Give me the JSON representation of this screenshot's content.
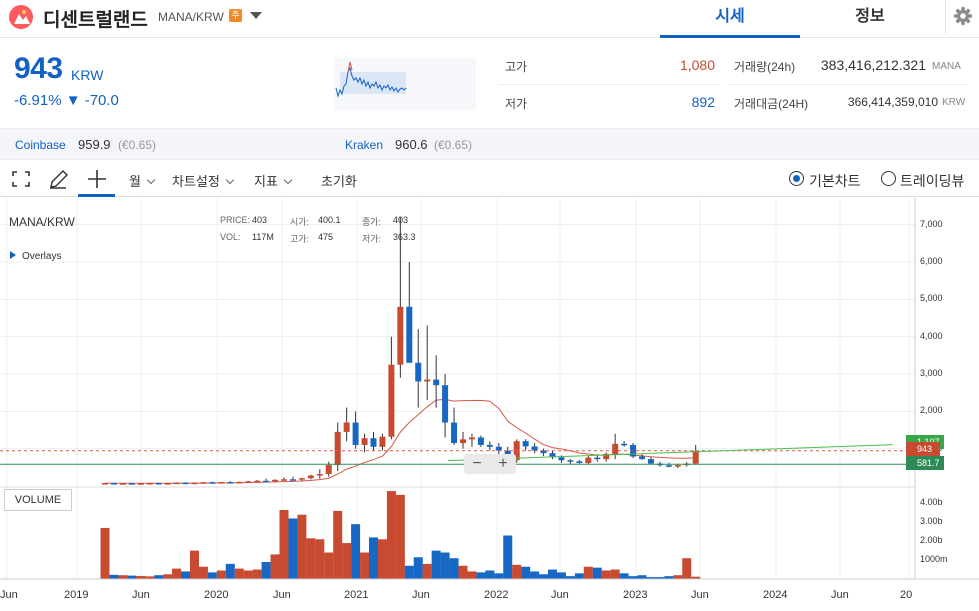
{
  "header": {
    "coin_name": "디센트럴랜드",
    "pair": "MANA/KRW",
    "warning_badge": "주",
    "tabs": [
      {
        "label": "시세"
      },
      {
        "label": "정보"
      }
    ]
  },
  "quote": {
    "price": "943",
    "unit": "KRW",
    "change": "-6.91% ▼ -70.0",
    "high_label": "고가",
    "high_value": "1,080",
    "low_label": "저가",
    "low_value": "892",
    "volume_label": "거래량(24h)",
    "volume_value": "383,416,212.321",
    "volume_unit": "MANA",
    "amount_label": "거래대금(24H)",
    "amount_value": "366,414,359,010",
    "amount_unit": "KRW"
  },
  "exchanges": [
    {
      "name": "Coinbase",
      "value": "959.9",
      "sub": "(€0.65)"
    },
    {
      "name": "Kraken",
      "value": "960.6",
      "sub": "(€0.65)"
    }
  ],
  "toolbar": {
    "period": "월",
    "chart_settings": "차트설정",
    "indicators": "지표",
    "reset": "초기화",
    "basic_chart": "기본차트",
    "tradingview": "트레이딩뷰"
  },
  "chart_panel": {
    "symbol": "MANA/KRW",
    "price_label": "PRICE:",
    "price_value": "403",
    "vol_label": "VOL:",
    "vol_value": "117M",
    "open_label": "시가:",
    "open_value": "400.1",
    "high_label": "고가:",
    "high_value": "475",
    "close_label": "종가:",
    "close_value": "403",
    "low_label": "저가:",
    "low_value": "363.3",
    "overlays": "Overlays",
    "volume_button": "VOLUME",
    "zoom_out": "−",
    "zoom_in": "+",
    "last_price_tag": "943",
    "green_tag": "1,107",
    "teal_tag": "581.7"
  },
  "colors": {
    "up": "#c84a31",
    "down": "#1768c5",
    "accent": "#1261c4"
  },
  "chart_data": {
    "type": "bar",
    "y_ticks": [
      "7,000",
      "6,000",
      "5,000",
      "4,000",
      "3,000",
      "2,000",
      "1,000"
    ],
    "vol_ticks": [
      "4.00b",
      "3.00b",
      "2.00b",
      "1000m"
    ],
    "x_ticks": [
      "Jun",
      "2019",
      "Jun",
      "2020",
      "Jun",
      "2021",
      "Jun",
      "2022",
      "Jun",
      "2023",
      "Jun",
      "2024",
      "Jun",
      "20"
    ],
    "ylim": [
      0,
      7500
    ],
    "vol_max": 4.6,
    "reference_lines": {
      "last_price": 943,
      "teal": 581.7,
      "green_end": 1107
    },
    "ohlc": [
      [
        75,
        80,
        60,
        78
      ],
      [
        78,
        85,
        65,
        72
      ],
      [
        72,
        80,
        60,
        75
      ],
      [
        75,
        82,
        62,
        70
      ],
      [
        70,
        78,
        58,
        74
      ],
      [
        74,
        85,
        60,
        80
      ],
      [
        80,
        90,
        65,
        72
      ],
      [
        72,
        85,
        60,
        78
      ],
      [
        78,
        95,
        65,
        90
      ],
      [
        90,
        100,
        70,
        75
      ],
      [
        75,
        95,
        65,
        88
      ],
      [
        88,
        110,
        70,
        100
      ],
      [
        100,
        120,
        80,
        92
      ],
      [
        92,
        110,
        75,
        105
      ],
      [
        105,
        130,
        85,
        98
      ],
      [
        98,
        120,
        80,
        110
      ],
      [
        110,
        140,
        90,
        125
      ],
      [
        125,
        160,
        100,
        140
      ],
      [
        140,
        200,
        110,
        130
      ],
      [
        130,
        180,
        100,
        165
      ],
      [
        165,
        230,
        140,
        180
      ],
      [
        180,
        250,
        150,
        170
      ],
      [
        170,
        220,
        140,
        210
      ],
      [
        210,
        300,
        180,
        280
      ],
      [
        280,
        450,
        200,
        320
      ],
      [
        320,
        650,
        250,
        560
      ],
      [
        560,
        1700,
        400,
        1450
      ],
      [
        1450,
        2100,
        1200,
        1700
      ],
      [
        1700,
        2000,
        1000,
        1100
      ],
      [
        1100,
        1400,
        900,
        1280
      ],
      [
        1280,
        1450,
        950,
        1050
      ],
      [
        1050,
        1400,
        950,
        1320
      ],
      [
        1320,
        4000,
        1250,
        3250
      ],
      [
        3250,
        7200,
        2900,
        4800
      ],
      [
        4800,
        6000,
        3500,
        3300
      ],
      [
        3300,
        4200,
        2100,
        2800
      ],
      [
        2800,
        4300,
        2300,
        2850
      ],
      [
        2850,
        3500,
        2100,
        2700
      ],
      [
        2700,
        3000,
        1300,
        1700
      ],
      [
        1700,
        2100,
        1100,
        1150
      ],
      [
        1150,
        1450,
        1000,
        1250
      ],
      [
        1250,
        1400,
        1050,
        1300
      ],
      [
        1300,
        1350,
        1050,
        1100
      ],
      [
        1100,
        1200,
        950,
        1050
      ],
      [
        1050,
        1150,
        850,
        950
      ],
      [
        950,
        1050,
        650,
        690
      ],
      [
        690,
        1250,
        620,
        1200
      ],
      [
        1200,
        1250,
        950,
        1060
      ],
      [
        1060,
        1150,
        880,
        950
      ],
      [
        950,
        1000,
        800,
        880
      ],
      [
        880,
        950,
        720,
        770
      ],
      [
        770,
        820,
        620,
        690
      ],
      [
        690,
        720,
        590,
        660
      ],
      [
        660,
        700,
        600,
        615
      ],
      [
        615,
        820,
        590,
        760
      ],
      [
        760,
        850,
        650,
        720
      ],
      [
        720,
        900,
        650,
        860
      ],
      [
        860,
        1400,
        720,
        1130
      ],
      [
        1130,
        1200,
        1050,
        1100
      ],
      [
        1100,
        1150,
        750,
        790
      ],
      [
        790,
        850,
        700,
        720
      ],
      [
        720,
        780,
        580,
        600
      ],
      [
        600,
        650,
        520,
        555
      ],
      [
        555,
        620,
        500,
        520
      ],
      [
        520,
        600,
        480,
        560
      ],
      [
        560,
        640,
        520,
        600
      ],
      [
        600,
        1100,
        570,
        943
      ]
    ],
    "volume": [
      2.7,
      0.22,
      0.2,
      0.18,
      0.16,
      0.14,
      0.2,
      0.25,
      0.55,
      0.4,
      1.5,
      0.65,
      0.35,
      0.45,
      0.8,
      0.55,
      0.45,
      0.5,
      0.9,
      1.3,
      3.65,
      3.2,
      3.4,
      2.15,
      2.1,
      1.4,
      3.6,
      1.9,
      2.9,
      1.4,
      2.2,
      2.1,
      4.65,
      4.45,
      0.7,
      1.15,
      0.8,
      1.5,
      1.4,
      1.1,
      0.7,
      0.4,
      0.35,
      0.45,
      0.3,
      2.3,
      0.75,
      0.65,
      0.4,
      0.25,
      0.5,
      0.35,
      0.15,
      0.3,
      0.65,
      0.6,
      0.45,
      0.5,
      0.3,
      0.15,
      0.2,
      0.1,
      0.1,
      0.15,
      0.2,
      1.1,
      0.12
    ]
  }
}
